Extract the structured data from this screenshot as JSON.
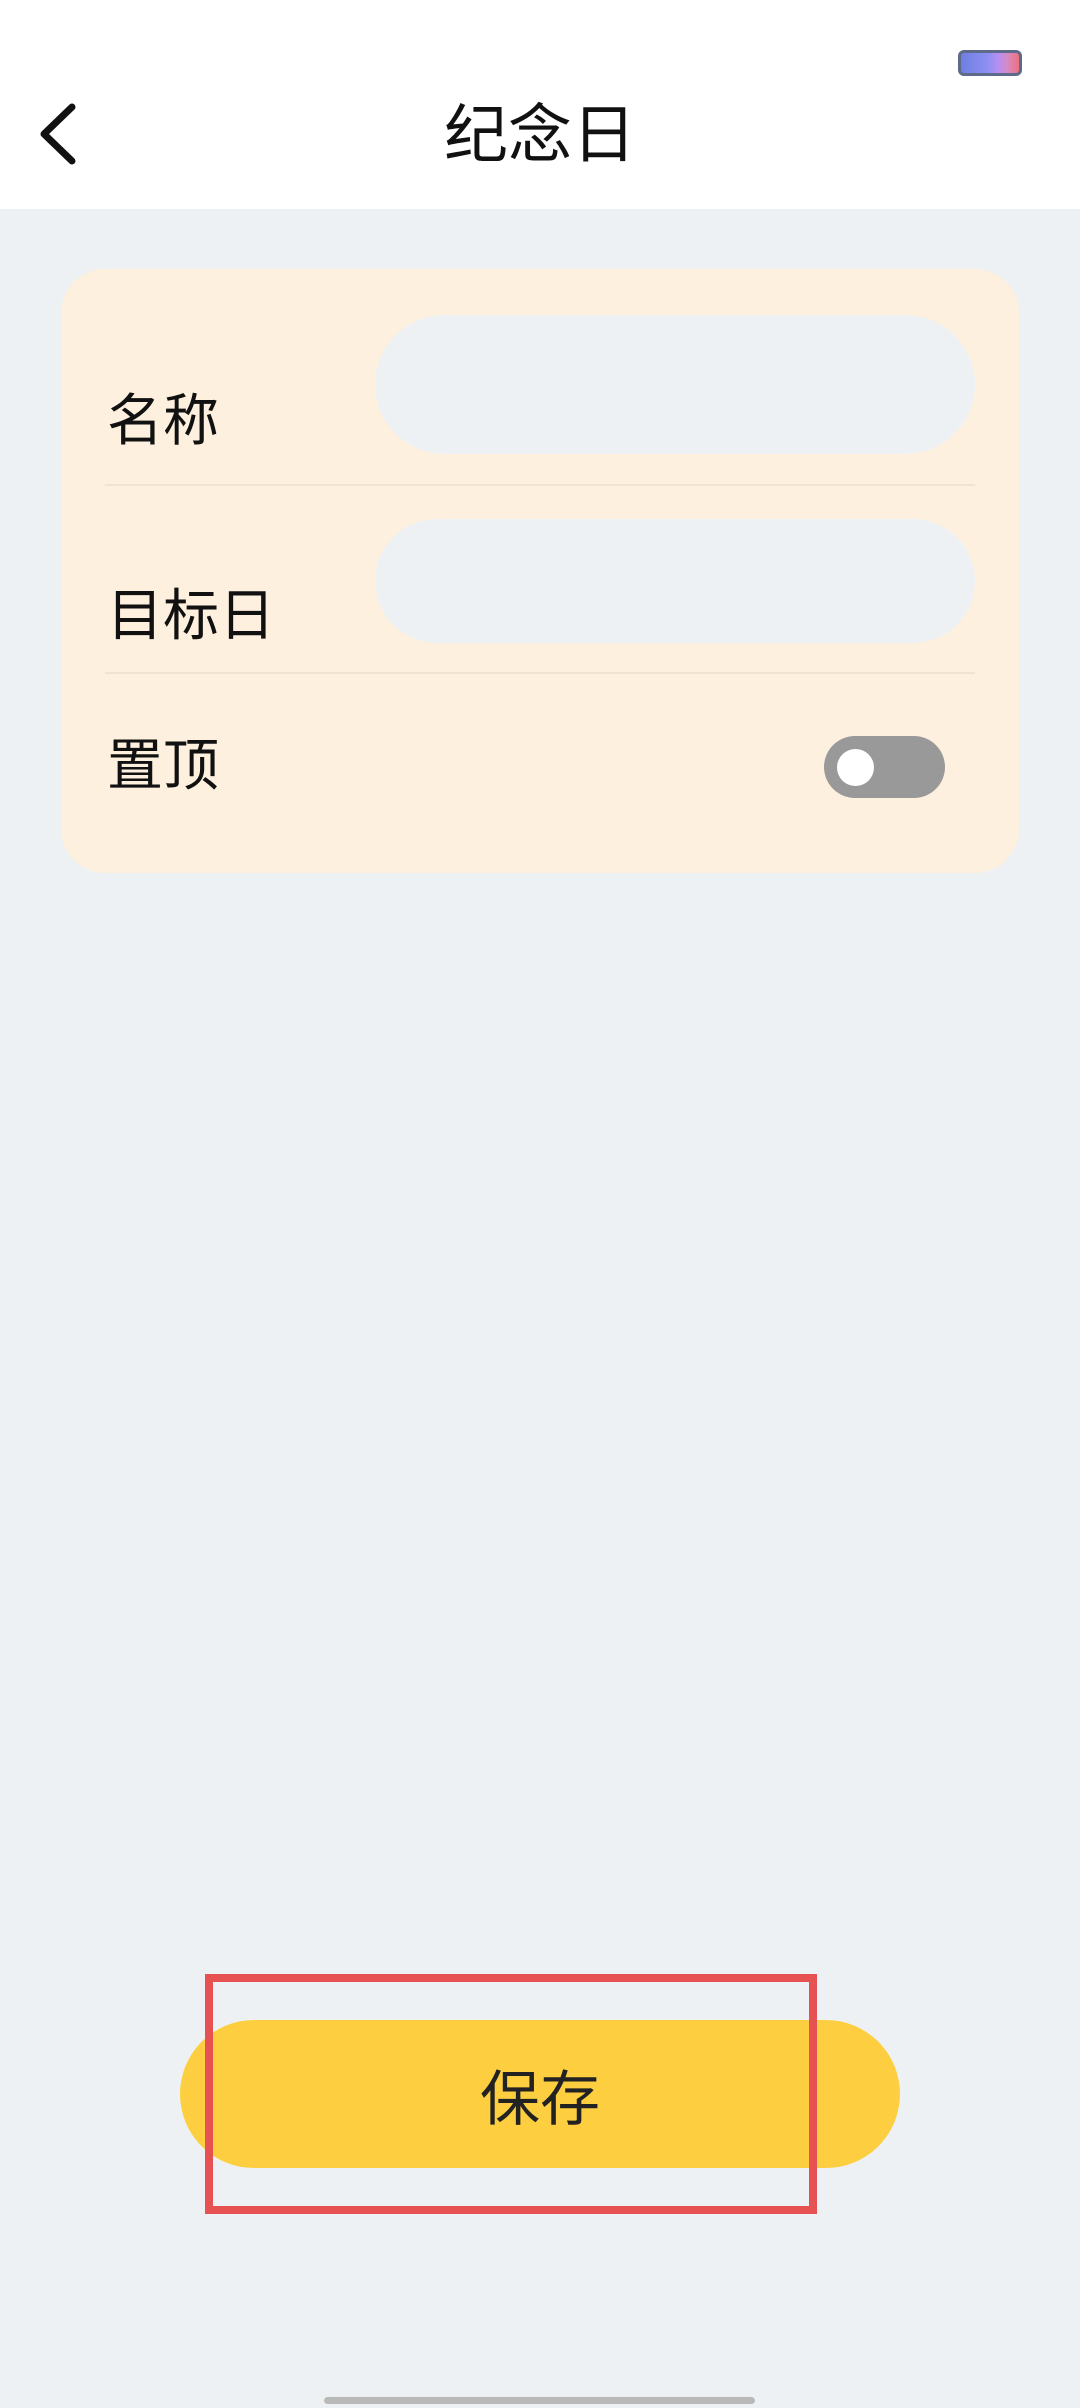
{
  "header": {
    "title": "纪念日",
    "back_icon": "chevron-left-icon",
    "battery_icon": "battery-icon"
  },
  "form": {
    "name_label": "名称",
    "name_value": "",
    "target_date_label": "目标日",
    "target_date_value": "",
    "pin_label": "置顶",
    "pin_enabled": false
  },
  "actions": {
    "save_label": "保存"
  },
  "colors": {
    "page_bg": "#eef1f4",
    "card_bg": "#fdf0de",
    "save_button": "#fdcf40",
    "toggle_off": "#999999",
    "highlight": "#e65252"
  }
}
